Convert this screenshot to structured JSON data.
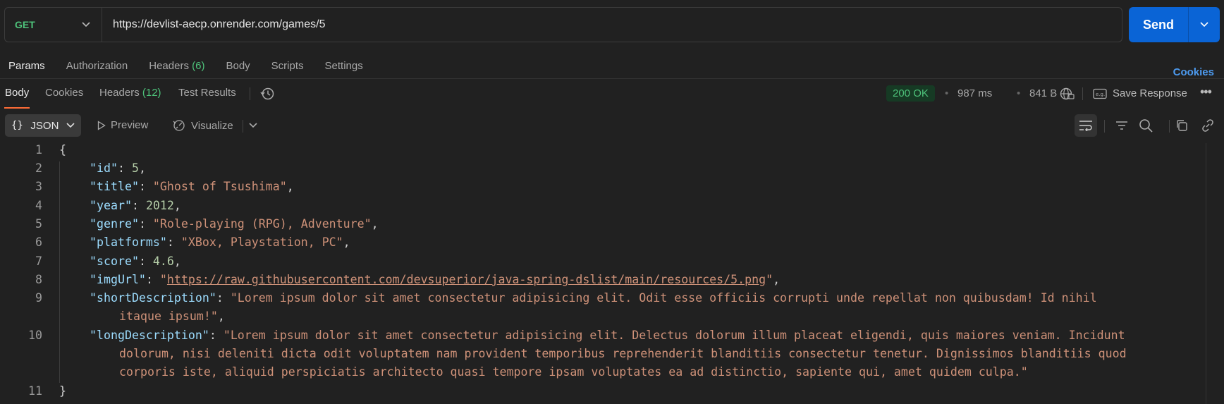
{
  "request": {
    "method": "GET",
    "url": "https://devlist-aecp.onrender.com/games/5",
    "send_label": "Send"
  },
  "request_tabs": [
    {
      "label": "Params"
    },
    {
      "label": "Authorization"
    },
    {
      "label": "Headers",
      "count": "(6)"
    },
    {
      "label": "Body"
    },
    {
      "label": "Scripts"
    },
    {
      "label": "Settings"
    }
  ],
  "cookies_link": "Cookies",
  "response": {
    "tabs": [
      {
        "label": "Body"
      },
      {
        "label": "Cookies"
      },
      {
        "label": "Headers",
        "count": "(12)"
      },
      {
        "label": "Test Results"
      }
    ],
    "status": "200 OK",
    "time": "987 ms",
    "size": "841 B",
    "save_label": "Save Response"
  },
  "viewer": {
    "format": "JSON",
    "preview_label": "Preview",
    "visualize_label": "Visualize"
  },
  "json_body": {
    "id": "5",
    "title": "\"Ghost of Tsushima\"",
    "year": "2012",
    "genre": "\"Role-playing (RPG), Adventure\"",
    "platforms": "\"XBox, Playstation, PC\"",
    "score": "4.6",
    "imgUrl": "https://raw.githubusercontent.com/devsuperior/java-spring-dslist/main/resources/5.png",
    "shortDescription_1": "\"Lorem ipsum dolor sit amet consectetur adipisicing elit. Odit esse officiis corrupti unde repellat non quibusdam! Id nihil",
    "shortDescription_2": "itaque ipsum!\"",
    "longDescription_1": "\"Lorem ipsum dolor sit amet consectetur adipisicing elit. Delectus dolorum illum placeat eligendi, quis maiores veniam. Incidunt",
    "longDescription_2": "dolorum, nisi deleniti dicta odit voluptatem nam provident temporibus reprehenderit blanditiis consectetur tenetur. Dignissimos blanditiis quod",
    "longDescription_3": "corporis iste, aliquid perspiciatis architecto quasi tempore ipsam voluptates ea ad distinctio, sapiente qui, amet quidem culpa.\""
  },
  "line_numbers": [
    "1",
    "2",
    "3",
    "4",
    "5",
    "6",
    "7",
    "8",
    "9",
    "10",
    "11"
  ],
  "colors": {
    "accent": "#0a64d6",
    "ok": "#4ec27a",
    "active_tab": "#ff6c37"
  }
}
